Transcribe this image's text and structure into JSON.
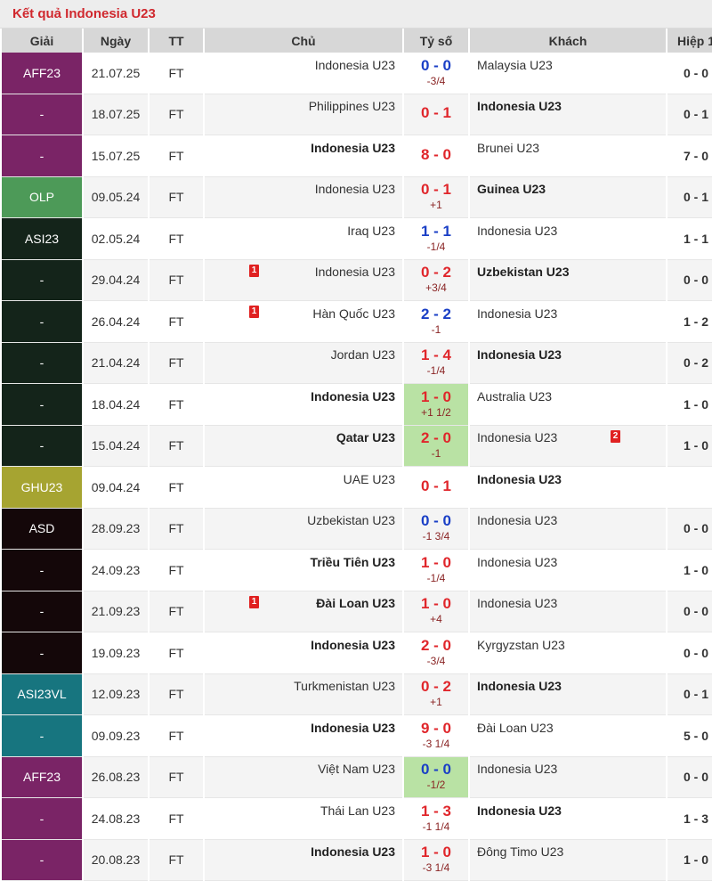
{
  "title": "Kết quả Indonesia U23",
  "headers": [
    "Giải",
    "Ngày",
    "TT",
    "Chủ",
    "Tỷ số",
    "Khách",
    "Hiệp 1"
  ],
  "colors": {
    "AFF23": "#7a2466",
    "OLP": "#4d9a58",
    "ASI23": "#14241a",
    "GHU23": "#a6a431",
    "ASD": "#140709",
    "ASI23VL": "#17757f",
    "win_highlight": "#b9e2a4",
    "title_red": "#d0282e"
  },
  "rows": [
    {
      "league": "AFF23",
      "league_color": "#7a2466",
      "date": "21.07.25",
      "status": "FT",
      "home": "Indonesia U23",
      "home_bold": false,
      "home_card": "",
      "score": "0 - 0",
      "score_color": "blue",
      "handicap": "-3/4",
      "away": "Malaysia U23",
      "away_bold": false,
      "away_card": "",
      "half": "0 - 0",
      "win": false
    },
    {
      "league": "-",
      "league_color": "#7a2466",
      "date": "18.07.25",
      "status": "FT",
      "home": "Philippines U23",
      "home_bold": false,
      "home_card": "",
      "score": "0 - 1",
      "score_color": "red",
      "handicap": "",
      "away": "Indonesia U23",
      "away_bold": true,
      "away_card": "",
      "half": "0 - 1",
      "win": false
    },
    {
      "league": "-",
      "league_color": "#7a2466",
      "date": "15.07.25",
      "status": "FT",
      "home": "Indonesia U23",
      "home_bold": true,
      "home_card": "",
      "score": "8 - 0",
      "score_color": "red",
      "handicap": "",
      "away": "Brunei U23",
      "away_bold": false,
      "away_card": "",
      "half": "7 - 0",
      "win": false
    },
    {
      "league": "OLP",
      "league_color": "#4d9a58",
      "date": "09.05.24",
      "status": "FT",
      "home": "Indonesia U23",
      "home_bold": false,
      "home_card": "",
      "score": "0 - 1",
      "score_color": "red",
      "handicap": "+1",
      "away": "Guinea U23",
      "away_bold": true,
      "away_card": "",
      "half": "0 - 1",
      "win": false
    },
    {
      "league": "ASI23",
      "league_color": "#14241a",
      "date": "02.05.24",
      "status": "FT",
      "home": "Iraq U23",
      "home_bold": false,
      "home_card": "",
      "score": "1 - 1",
      "score_color": "blue",
      "handicap": "-1/4",
      "away": "Indonesia U23",
      "away_bold": false,
      "away_card": "",
      "half": "1 - 1",
      "win": false
    },
    {
      "league": "-",
      "league_color": "#14241a",
      "date": "29.04.24",
      "status": "FT",
      "home": "Indonesia U23",
      "home_bold": false,
      "home_card": "1",
      "score": "0 - 2",
      "score_color": "red",
      "handicap": "+3/4",
      "away": "Uzbekistan U23",
      "away_bold": true,
      "away_card": "",
      "half": "0 - 0",
      "win": false
    },
    {
      "league": "-",
      "league_color": "#14241a",
      "date": "26.04.24",
      "status": "FT",
      "home": "Hàn Quốc U23",
      "home_bold": false,
      "home_card": "1",
      "score": "2 - 2",
      "score_color": "blue",
      "handicap": "-1",
      "away": "Indonesia U23",
      "away_bold": false,
      "away_card": "",
      "half": "1 - 2",
      "win": false
    },
    {
      "league": "-",
      "league_color": "#14241a",
      "date": "21.04.24",
      "status": "FT",
      "home": "Jordan U23",
      "home_bold": false,
      "home_card": "",
      "score": "1 - 4",
      "score_color": "red",
      "handicap": "-1/4",
      "away": "Indonesia U23",
      "away_bold": true,
      "away_card": "",
      "half": "0 - 2",
      "win": false
    },
    {
      "league": "-",
      "league_color": "#14241a",
      "date": "18.04.24",
      "status": "FT",
      "home": "Indonesia U23",
      "home_bold": true,
      "home_card": "",
      "score": "1 - 0",
      "score_color": "red",
      "handicap": "+1 1/2",
      "away": "Australia U23",
      "away_bold": false,
      "away_card": "",
      "half": "1 - 0",
      "win": true
    },
    {
      "league": "-",
      "league_color": "#14241a",
      "date": "15.04.24",
      "status": "FT",
      "home": "Qatar U23",
      "home_bold": true,
      "home_card": "",
      "score": "2 - 0",
      "score_color": "red",
      "handicap": "-1",
      "away": "Indonesia U23",
      "away_bold": false,
      "away_card": "2",
      "half": "1 - 0",
      "win": true
    },
    {
      "league": "GHU23",
      "league_color": "#a6a431",
      "date": "09.04.24",
      "status": "FT",
      "home": "UAE U23",
      "home_bold": false,
      "home_card": "",
      "score": "0 - 1",
      "score_color": "red",
      "handicap": "",
      "away": "Indonesia U23",
      "away_bold": true,
      "away_card": "",
      "half": "",
      "win": false
    },
    {
      "league": "ASD",
      "league_color": "#140709",
      "date": "28.09.23",
      "status": "FT",
      "home": "Uzbekistan U23",
      "home_bold": false,
      "home_card": "",
      "score": "0 - 0",
      "score_color": "blue",
      "handicap": "-1 3/4",
      "away": "Indonesia U23",
      "away_bold": false,
      "away_card": "",
      "half": "0 - 0",
      "win": false
    },
    {
      "league": "-",
      "league_color": "#140709",
      "date": "24.09.23",
      "status": "FT",
      "home": "Triều Tiên U23",
      "home_bold": true,
      "home_card": "",
      "score": "1 - 0",
      "score_color": "red",
      "handicap": "-1/4",
      "away": "Indonesia U23",
      "away_bold": false,
      "away_card": "",
      "half": "1 - 0",
      "win": false
    },
    {
      "league": "-",
      "league_color": "#140709",
      "date": "21.09.23",
      "status": "FT",
      "home": "Đài Loan U23",
      "home_bold": true,
      "home_card": "1",
      "score": "1 - 0",
      "score_color": "red",
      "handicap": "+4",
      "away": "Indonesia U23",
      "away_bold": false,
      "away_card": "",
      "half": "0 - 0",
      "win": false
    },
    {
      "league": "-",
      "league_color": "#140709",
      "date": "19.09.23",
      "status": "FT",
      "home": "Indonesia U23",
      "home_bold": true,
      "home_card": "",
      "score": "2 - 0",
      "score_color": "red",
      "handicap": "-3/4",
      "away": "Kyrgyzstan U23",
      "away_bold": false,
      "away_card": "",
      "half": "0 - 0",
      "win": false
    },
    {
      "league": "ASI23VL",
      "league_color": "#17757f",
      "date": "12.09.23",
      "status": "FT",
      "home": "Turkmenistan U23",
      "home_bold": false,
      "home_card": "",
      "score": "0 - 2",
      "score_color": "red",
      "handicap": "+1",
      "away": "Indonesia U23",
      "away_bold": true,
      "away_card": "",
      "half": "0 - 1",
      "win": false
    },
    {
      "league": "-",
      "league_color": "#17757f",
      "date": "09.09.23",
      "status": "FT",
      "home": "Indonesia U23",
      "home_bold": true,
      "home_card": "",
      "score": "9 - 0",
      "score_color": "red",
      "handicap": "-3 1/4",
      "away": "Đài Loan U23",
      "away_bold": false,
      "away_card": "",
      "half": "5 - 0",
      "win": false
    },
    {
      "league": "AFF23",
      "league_color": "#7a2466",
      "date": "26.08.23",
      "status": "FT",
      "home": "Việt Nam U23",
      "home_bold": false,
      "home_card": "",
      "score": "0 - 0",
      "score_color": "blue",
      "handicap": "-1/2",
      "away": "Indonesia U23",
      "away_bold": false,
      "away_card": "",
      "half": "0 - 0",
      "win": true
    },
    {
      "league": "-",
      "league_color": "#7a2466",
      "date": "24.08.23",
      "status": "FT",
      "home": "Thái Lan U23",
      "home_bold": false,
      "home_card": "",
      "score": "1 - 3",
      "score_color": "red",
      "handicap": "-1 1/4",
      "away": "Indonesia U23",
      "away_bold": true,
      "away_card": "",
      "half": "1 - 3",
      "win": false
    },
    {
      "league": "-",
      "league_color": "#7a2466",
      "date": "20.08.23",
      "status": "FT",
      "home": "Indonesia U23",
      "home_bold": true,
      "home_card": "",
      "score": "1 - 0",
      "score_color": "red",
      "handicap": "-3 1/4",
      "away": "Đông Timo U23",
      "away_bold": false,
      "away_card": "",
      "half": "1 - 0",
      "win": false
    }
  ]
}
